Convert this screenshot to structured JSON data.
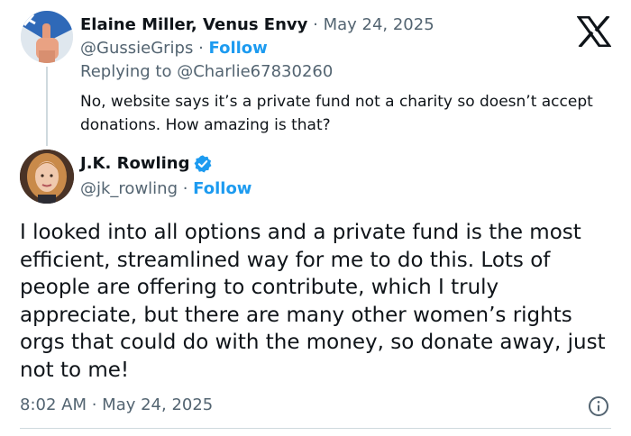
{
  "parent_tweet": {
    "display_name": "Elaine Miller, Venus Envy",
    "separator": " · ",
    "date": "May 24, 2025",
    "handle": "@GussieGrips",
    "follow_label": "Follow",
    "replying_to_prefix": "Replying to ",
    "replying_to_handle": "@Charlie67830260",
    "text": "No, website says it’s a private fund not a charity so doesn’t accept donations.  How amazing is that?"
  },
  "main_tweet": {
    "display_name": "J.K. Rowling",
    "verified": true,
    "handle": "@jk_rowling",
    "separator": " · ",
    "follow_label": "Follow",
    "text": "I looked into all options and a private fund is the most efficient, streamlined way for me to do this. Lots of people are offering to contribute, which I truly appreciate, but there are many other women’s rights orgs that could do with the money, so donate away, just not to me!",
    "time": "8:02 AM",
    "date": "May 24, 2025"
  },
  "icons": {
    "brand": "x-logo-icon",
    "verified": "verified-badge-icon",
    "info": "info-icon"
  },
  "colors": {
    "link": "#1d9bf0",
    "muted": "#536471",
    "text": "#0f1419"
  }
}
